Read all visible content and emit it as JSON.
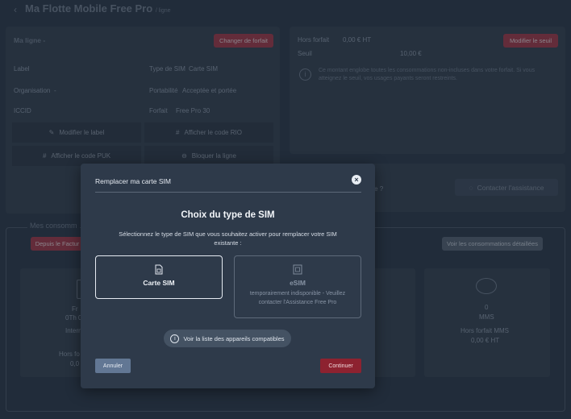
{
  "header": {
    "title": "Ma Flotte Mobile Free Pro",
    "breadcrumb": "/ ligne"
  },
  "line_panel": {
    "title": "Ma ligne -",
    "change_plan_button": "Changer de forfait",
    "fields": [
      {
        "label": "Label",
        "value": ""
      },
      {
        "label": "Type de SIM",
        "value": "Carte SIM"
      },
      {
        "label": "Organisation",
        "value": "-"
      },
      {
        "label": "Portabilité",
        "value": "Acceptée et portée"
      },
      {
        "label": "ICCID",
        "value": ""
      },
      {
        "label": "Forfait",
        "value": "Free Pro 30"
      }
    ],
    "actions": {
      "edit_label": "Modifier le label",
      "show_rio": "Afficher le code RIO",
      "show_puk": "Afficher le code PUK",
      "block_line": "Bloquer la ligne"
    }
  },
  "threshold_panel": {
    "off_plan_label": "Hors forfait",
    "off_plan_value": "0,00 € HT",
    "threshold_label": "Seuil",
    "threshold_value": "10,00 €",
    "edit_threshold_button": "Modifier le seuil",
    "info_text": "Ce montant englobe toutes les consommations non-incluses dans votre forfait. Si vous atteignez le seuil, vos usages payants seront restreints."
  },
  "assistance": {
    "question_fragment": "ème ?",
    "button": "Contacter l'assistance"
  },
  "consumption": {
    "title": "Mes consomm",
    "since_button": "Depuis le Factur",
    "details_button": "Voir les consommations détaillées",
    "card_left": {
      "line1": "Fr",
      "line2": "0Th 0",
      "line3": "Intern",
      "line4": "Hors fo",
      "line5": "0,0"
    },
    "card_right": {
      "count": "0",
      "type": "MMS",
      "off_plan_label": "Hors forfait MMS",
      "off_plan_value": "0,00 € HT"
    }
  },
  "modal": {
    "title": "Remplacer ma carte SIM",
    "heading": "Choix du type de SIM",
    "description": "Sélectionnez le type de SIM que vous souhaitez activer pour remplacer votre SIM existante :",
    "option_sim": "Carte SIM",
    "option_esim": "eSIM",
    "option_esim_note": "temporairement indisponible - Veuillez contacter l'Assistance Free Pro",
    "compat_link": "Voir la liste des appareils compatibles",
    "cancel_button": "Annuler",
    "continue_button": "Continuer"
  }
}
